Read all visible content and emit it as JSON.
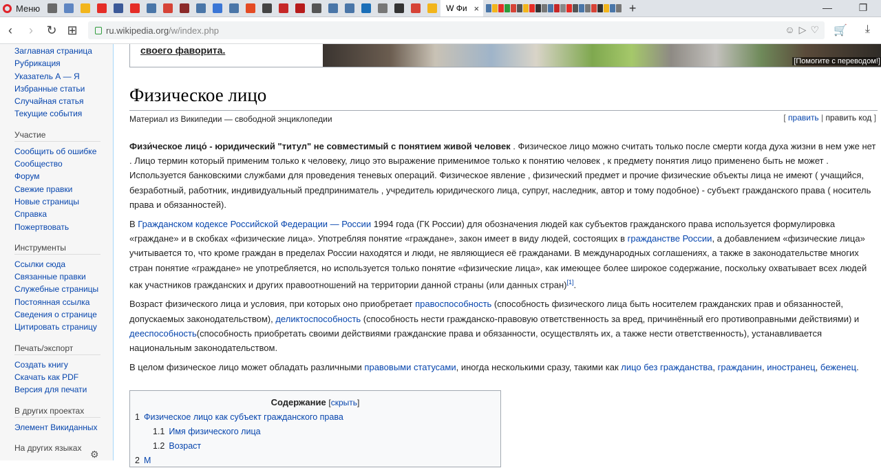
{
  "browser": {
    "menu_label": "Меню",
    "active_tab_label": "W Фи",
    "tab_close": "×",
    "new_tab": "+",
    "url_host": "ru.wikipedia.org",
    "url_path": "/w/index.php",
    "fav_colors": [
      "#6a6a6a",
      "#5f86c2",
      "#f2b51c",
      "#e52d27",
      "#3b5998",
      "#e52d27",
      "#4a76a8",
      "#d64337",
      "#8b2a2a",
      "#4a76a8",
      "#3a76d6",
      "#4a76a8",
      "#e44b24",
      "#444",
      "#c62828",
      "#b71c1c",
      "#555",
      "#4a76a8",
      "#4a76a8",
      "#1b6fb8",
      "#777",
      "#333",
      "#d64337",
      "#f2b51c"
    ]
  },
  "sidebar": {
    "main": [
      "Заглавная страница",
      "Рубрикация",
      "Указатель А — Я",
      "Избранные статьи",
      "Случайная статья",
      "Текущие события"
    ],
    "participation_title": "Участие",
    "participation": [
      "Сообщить об ошибке",
      "Сообщество",
      "Форум",
      "Свежие правки",
      "Новые страницы",
      "Справка",
      "Пожертвовать"
    ],
    "tools_title": "Инструменты",
    "tools": [
      "Ссылки сюда",
      "Связанные правки",
      "Служебные страницы",
      "Постоянная ссылка",
      "Сведения о странице",
      "Цитировать страницу"
    ],
    "print_title": "Печать/экспорт",
    "print": [
      "Создать книгу",
      "Скачать как PDF",
      "Версия для печати"
    ],
    "projects_title": "В других проектах",
    "projects": [
      "Элемент Викиданных"
    ],
    "languages_title": "На других языках"
  },
  "banner": {
    "text": "своего фаворита.",
    "caption": "[Помогите с переводом!]"
  },
  "article": {
    "title": "Физическое лицо",
    "site_sub": "Материал из Википедии — свободной энциклопедии",
    "edit_open": "[",
    "edit": "править",
    "sep": "|",
    "edit_code": "править код",
    "edit_close": "]",
    "p1_bold": "Физи́ческое лицо́ - юридический \"титул\" не совместимый с понятием живой человек",
    "p1_text": " . Физическое лицо можно считать только после смерти когда духа жизни в нем уже нет . Лицо термин который применим только к человеку, лицо это выражение применимое только к понятию человек , к предмету понятия лицо применено быть не может . Используется банковскими службами для проведения теневых операций. Физическое явление , физический предмет и прочие физические объекты лица не имеют ( учащийся, безработный, работник, индивидуальный предприниматель , учредитель юридического лица, супруг, наследник, автор и тому подобное) - субъект гражданского права ( носитель права и обязанностей).",
    "p2_a": "В ",
    "p2_link1": "Гражданском кодексе Российской Федерации — России",
    "p2_b": " 1994 года (ГК России) для обозначения людей как субъектов гражданского права используется формулировка «граждане» и в скобках «физические лица». Употребляя понятие «граждане», закон имеет в виду людей, состоящих в ",
    "p2_link2": "гражданстве России",
    "p2_c": ", а добавлением «физические лица» учитывается то, что кроме граждан в пределах России находятся и люди, не являющиеся её гражданами. В международных соглашениях, а также в законодательстве многих стран понятие «граждане» не употребляется, но используется только понятие «физические лица», как имеющее более широкое содержание, поскольку охватывает всех людей как участников гражданских и других правоотношений на территории данной страны (или данных стран)",
    "p2_ref": "[1]",
    "p2_end": ".",
    "p3_a": "Возраст физического лица и условия, при которых оно приобретает ",
    "p3_link1": "правоспособность",
    "p3_b": " (способность физического лица быть носителем гражданских прав и обязанностей, допускаемых законодательством), ",
    "p3_link2": "деликтоспособность",
    "p3_c": " (способность нести гражданско-правовую ответственность за вред, причинённый его противоправными действиями) и ",
    "p3_link3": "дееспособность",
    "p3_d": "(способность приобретать своими действиями гражданские права и обязанности, осуществлять их, а также нести ответственность), устанавливается национальным законодательством.",
    "p4_a": "В целом физическое лицо может обладать различными ",
    "p4_link1": "правовыми статусами",
    "p4_b": ", иногда несколькими сразу, такими как ",
    "p4_link2": "лицо без гражданства",
    "p4_sep1": ", ",
    "p4_link3": "гражданин",
    "p4_sep2": ", ",
    "p4_link4": "иностранец",
    "p4_sep3": ", ",
    "p4_link5": "беженец",
    "p4_end": "."
  },
  "toc": {
    "title": "Содержание",
    "hide_open": "[",
    "hide": "скрыть",
    "hide_close": "]",
    "items": [
      {
        "num": "1",
        "label": "Физическое лицо как субъект гражданского права"
      },
      {
        "num": "1.1",
        "label": "Имя физического лица"
      },
      {
        "num": "1.2",
        "label": "Возраст"
      },
      {
        "num": "2",
        "label": "М"
      }
    ]
  }
}
